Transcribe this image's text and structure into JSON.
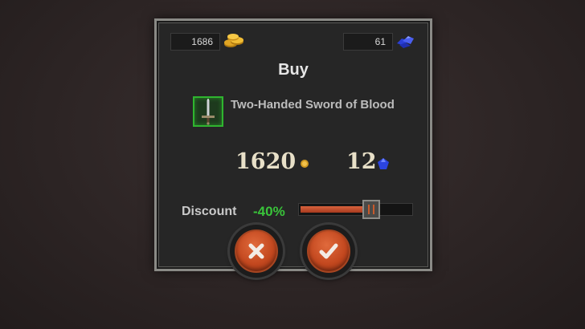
{
  "wallet": {
    "gold": "1686",
    "gems": "61",
    "gold_icon": "gold-coin-stack-icon",
    "gem_icon": "blue-gem-pile-icon"
  },
  "dialog": {
    "title": "Buy",
    "item": {
      "name": "Two-Handed Sword of Blood",
      "icon": "sword-icon",
      "rarity_color": "#2fb52f"
    },
    "price": {
      "gold": "1620",
      "gems": "12"
    },
    "discount": {
      "label": "Discount",
      "value": "-40%",
      "slider_level_percent": 58
    },
    "buttons": {
      "cancel_icon": "close-icon",
      "confirm_icon": "checkmark-icon"
    }
  },
  "colors": {
    "accent_orange": "#c3481f",
    "discount_green": "#39c43a",
    "panel_bg": "#262626"
  }
}
